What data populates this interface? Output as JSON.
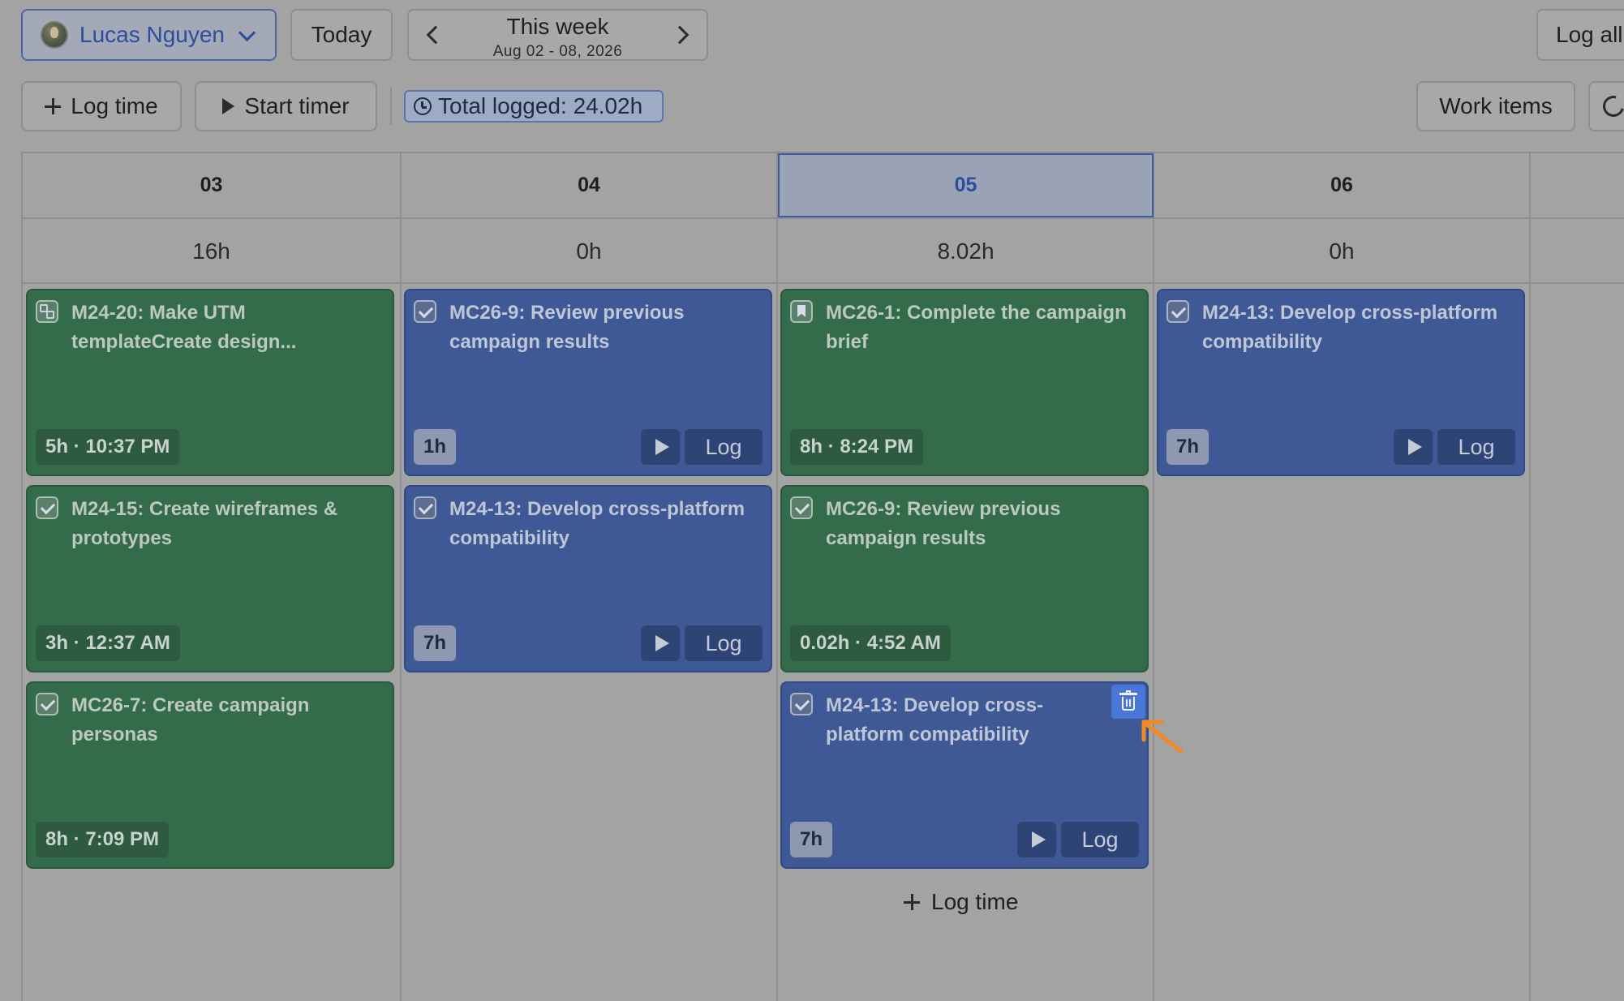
{
  "toolbar": {
    "user_name": "Lucas Nguyen",
    "today_label": "Today",
    "week_title": "This week",
    "week_range": "Aug 02 - 08, 2026",
    "log_all_label": "Log all",
    "log_time_label": "Log time",
    "start_timer_label": "Start timer",
    "total_logged": "Total logged: 24.02h",
    "work_items_label": "Work items"
  },
  "days": [
    {
      "label": "03",
      "total": "16h",
      "active": false
    },
    {
      "label": "04",
      "total": "0h",
      "active": false
    },
    {
      "label": "05",
      "total": "8.02h",
      "active": true
    },
    {
      "label": "06",
      "total": "0h",
      "active": false
    }
  ],
  "entries": {
    "d03": [
      {
        "title": "M24-20: Make UTM templateCreate design...",
        "duration": "5h · 10:37 PM",
        "color": "green",
        "icon": "subtask-icon"
      },
      {
        "title": "M24-15: Create wireframes & prototypes",
        "duration": "3h · 12:37 AM",
        "color": "green",
        "icon": "checkbox-icon"
      },
      {
        "title": "MC26-7: Create campaign personas",
        "duration": "8h · 7:09 PM",
        "color": "green",
        "icon": "checkbox-icon"
      }
    ],
    "d04": [
      {
        "title": "MC26-9: Review previous campaign results",
        "duration": "1h",
        "color": "blue",
        "icon": "checkbox-icon",
        "log_label": "Log"
      },
      {
        "title": "M24-13: Develop cross-platform compatibility",
        "duration": "7h",
        "color": "blue",
        "icon": "checkbox-icon",
        "log_label": "Log"
      }
    ],
    "d05": [
      {
        "title": "MC26-1: Complete the campaign brief",
        "duration": "8h · 8:24 PM",
        "color": "green",
        "icon": "bookmark-icon"
      },
      {
        "title": "MC26-9: Review previous campaign results",
        "duration": "0.02h · 4:52 AM",
        "color": "green",
        "icon": "checkbox-icon"
      },
      {
        "title": "M24-13: Develop cross-platform compatibility",
        "duration": "7h",
        "color": "blue",
        "icon": "checkbox-icon",
        "log_label": "Log"
      }
    ],
    "d06": [
      {
        "title": "M24-13: Develop cross-platform compatibility",
        "duration": "7h",
        "color": "blue",
        "icon": "checkbox-icon",
        "log_label": "Log"
      }
    ]
  },
  "add_log_label": "Log time",
  "colors": {
    "logged_green": "#346b4a",
    "planned_blue": "#3e5995",
    "active_day": "#2e4c9e",
    "delete_button": "#4a76d9",
    "cursor": "#f08a24"
  }
}
